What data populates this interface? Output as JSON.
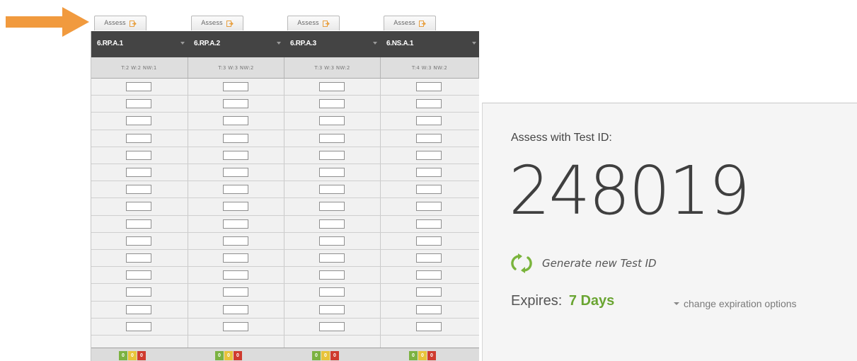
{
  "assess_label": "Assess",
  "standards": [
    {
      "code": "6.RP.A.1",
      "subs": "T:2  W:2  NW:1"
    },
    {
      "code": "6.RP.A.2",
      "subs": "T:3  W:3  NW:2"
    },
    {
      "code": "6.RP.A.3",
      "subs": "T:3  W:3  NW:2"
    },
    {
      "code": "6.NS.A.1",
      "subs": "T:4  W:3  NW:2"
    }
  ],
  "score_badges": [
    "0",
    "0",
    "0"
  ],
  "panel": {
    "title": "Assess with Test ID:",
    "test_id": "248019",
    "generate_label": "Generate new Test ID",
    "expires_label": "Expires:",
    "expires_value": "7 Days",
    "change_options_label": "change expiration options"
  },
  "colors": {
    "arrow": "#f19a3e",
    "accent_green": "#6aa532",
    "header_bar": "#444444",
    "score_green": "#7bb241",
    "score_yellow": "#e8c33a",
    "score_red": "#cf3b2f"
  },
  "icons": {
    "arrow": "arrow-right-icon",
    "export": "export-icon",
    "refresh": "refresh-icon",
    "dropdown": "caret-down-icon"
  }
}
